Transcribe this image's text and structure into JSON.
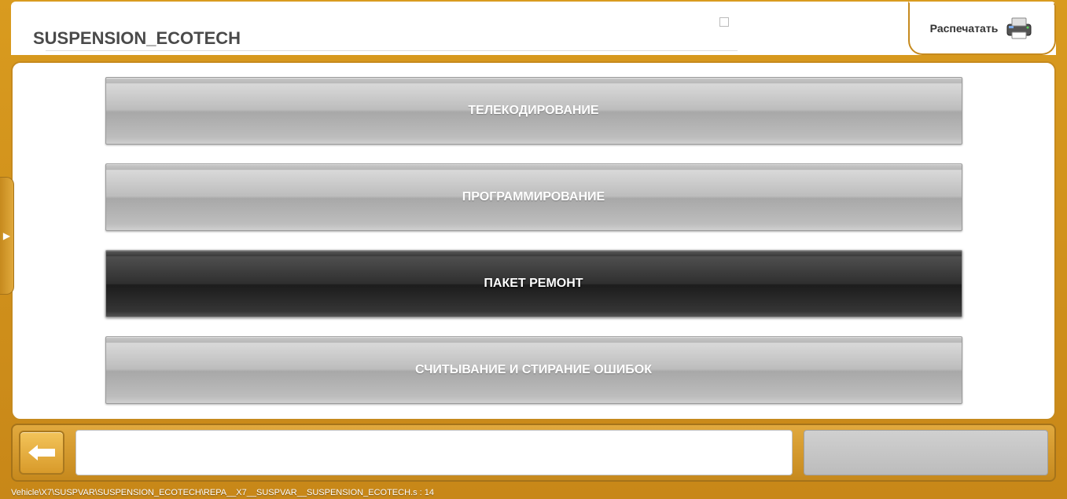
{
  "title": "SUSPENSION_ECOTECH",
  "print_label": "Распечатать",
  "menu": [
    {
      "label": "ТЕЛЕКОДИРОВАНИЕ",
      "selected": false
    },
    {
      "label": "ПРОГРАММИРОВАНИЕ",
      "selected": false
    },
    {
      "label": "ПАКЕТ РЕМОНТ",
      "selected": true
    },
    {
      "label": "СЧИТЫВАНИЕ И СТИРАНИЕ ОШИБОК",
      "selected": false
    }
  ],
  "status": "Vehicle\\X7\\SUSPVAR\\SUSPENSION_ECOTECH\\REPA__X7__SUSPVAR__SUSPENSION_ECOTECH.s : 14"
}
